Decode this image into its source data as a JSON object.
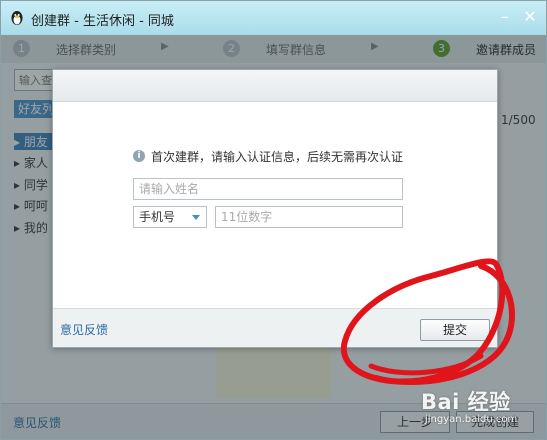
{
  "window": {
    "title": "创建群 - 生活休闲 - 同城",
    "minimize_glyph": "–",
    "close_glyph": "✕"
  },
  "steps": [
    {
      "num": "1",
      "label": "选择群类别",
      "active": false
    },
    {
      "num": "2",
      "label": "填写群信息",
      "active": false
    },
    {
      "num": "3",
      "label": "邀请群成员",
      "active": true
    }
  ],
  "step_arrow": "▶",
  "members": {
    "search_placeholder": "输入查找关键字",
    "friends_tab": "好友列",
    "count": "1/500",
    "groups": [
      {
        "label": "朋友",
        "selected": true
      },
      {
        "label": "家人",
        "selected": false
      },
      {
        "label": "同学",
        "selected": false
      },
      {
        "label": "呵呵",
        "selected": false
      },
      {
        "label": "我的",
        "selected": false
      }
    ]
  },
  "bottom": {
    "feedback": "意见反馈",
    "prev_button": "上一步",
    "next_button": "完成创建"
  },
  "dialog": {
    "notice": "首次建群，请输入认证信息，后续无需再次认证",
    "name_placeholder": "请输入姓名",
    "phone_type": "手机号",
    "phone_placeholder": "11位数字",
    "feedback": "意见反馈",
    "submit_button": "提交"
  },
  "watermark": {
    "brand": "Bai 经验",
    "url": "jingyan.baidu.com"
  },
  "colors": {
    "title_bar": "#a9dcea",
    "accent_blue": "#3b7fb8",
    "step_active": "#5a9c2a",
    "annotation_red": "#e0141a"
  },
  "icons": {
    "app": "qq-penguin-icon",
    "info": "info-icon",
    "dropdown": "caret-down-icon"
  }
}
